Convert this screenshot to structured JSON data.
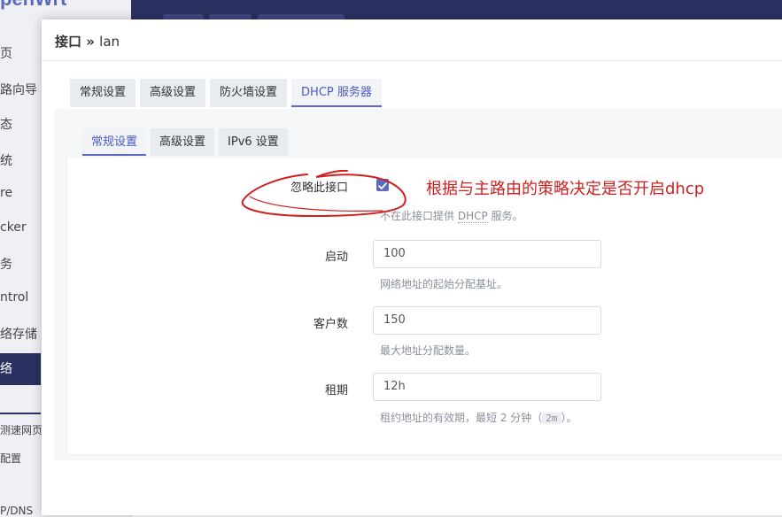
{
  "background": {
    "logo": "penWrt",
    "sidebar_items": [
      "页",
      "路向导",
      "态",
      "统",
      "re",
      "cker",
      "务",
      "ntrol",
      "络存储",
      "络"
    ],
    "sub_items": [
      "测速网页",
      "配置",
      "P/DNS"
    ]
  },
  "modal": {
    "title_prefix": "接口",
    "title_sep": " » ",
    "title_name": "lan",
    "tabs": [
      "常规设置",
      "高级设置",
      "防火墙设置",
      "DHCP 服务器"
    ],
    "subtabs": [
      "常规设置",
      "高级设置",
      "IPv6 设置"
    ],
    "fields": {
      "ignore": {
        "label": "忽略此接口",
        "checked": true,
        "help_pre": "不在此接口提供 ",
        "help_abbr": "DHCP",
        "help_post": " 服务。"
      },
      "start": {
        "label": "启动",
        "value": "100",
        "help": "网络地址的起始分配基址。"
      },
      "limit": {
        "label": "客户数",
        "value": "150",
        "help": "最大地址分配数量。"
      },
      "lease": {
        "label": "租期",
        "value": "12h",
        "help_pre": "租约地址的有效期，最短 2 分钟（",
        "help_code": "2m",
        "help_post": "）。"
      }
    }
  },
  "annotation": {
    "text": "根据与主路由的策略决定是否开启dhcp",
    "color": "#d01f1f"
  },
  "colors": {
    "accent": "#5b6abf",
    "header": "#2a3060"
  }
}
